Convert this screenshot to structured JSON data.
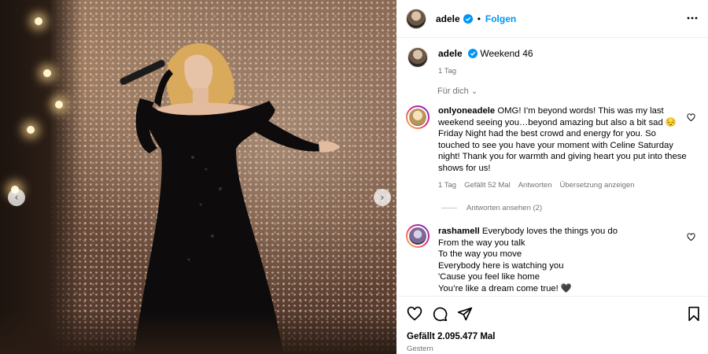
{
  "post": {
    "username": "adele",
    "follow_label": "Folgen",
    "caption": "Weekend 46",
    "caption_time": "1 Tag",
    "for_you_label": "Für dich",
    "likes": "Gefällt 2.095.477 Mal",
    "posted": "Gestern"
  },
  "comments": [
    {
      "username": "onlyoneadele",
      "text": "OMG! I’m beyond words! This was my last weekend seeing you…beyond amazing but also a bit sad 😔 Friday Night had the best crowd and energy for you. So touched to see you have your moment with Celine Saturday night! Thank you for warmth and giving heart you put into these shows for us!",
      "time": "1 Tag",
      "likes": "Gefällt 52 Mal",
      "reply": "Antworten",
      "translate": "Übersetzung anzeigen",
      "view_replies": "Antworten ansehen (2)"
    },
    {
      "username": "rashamell",
      "lines": [
        "Everybody loves the things you do",
        "From the way you talk",
        "To the way you move",
        "Everybody here is watching you",
        "'Cause you feel like home",
        "You’re like a dream come true! 🖤"
      ]
    }
  ],
  "icons": {
    "verified": "verified-badge-icon",
    "more": "more-options-icon",
    "like": "heart-icon",
    "comment": "comment-icon",
    "share": "share-icon",
    "save": "bookmark-icon"
  },
  "colors": {
    "accent": "#0095f6",
    "verified": "#0095f6",
    "muted": "#737373"
  }
}
